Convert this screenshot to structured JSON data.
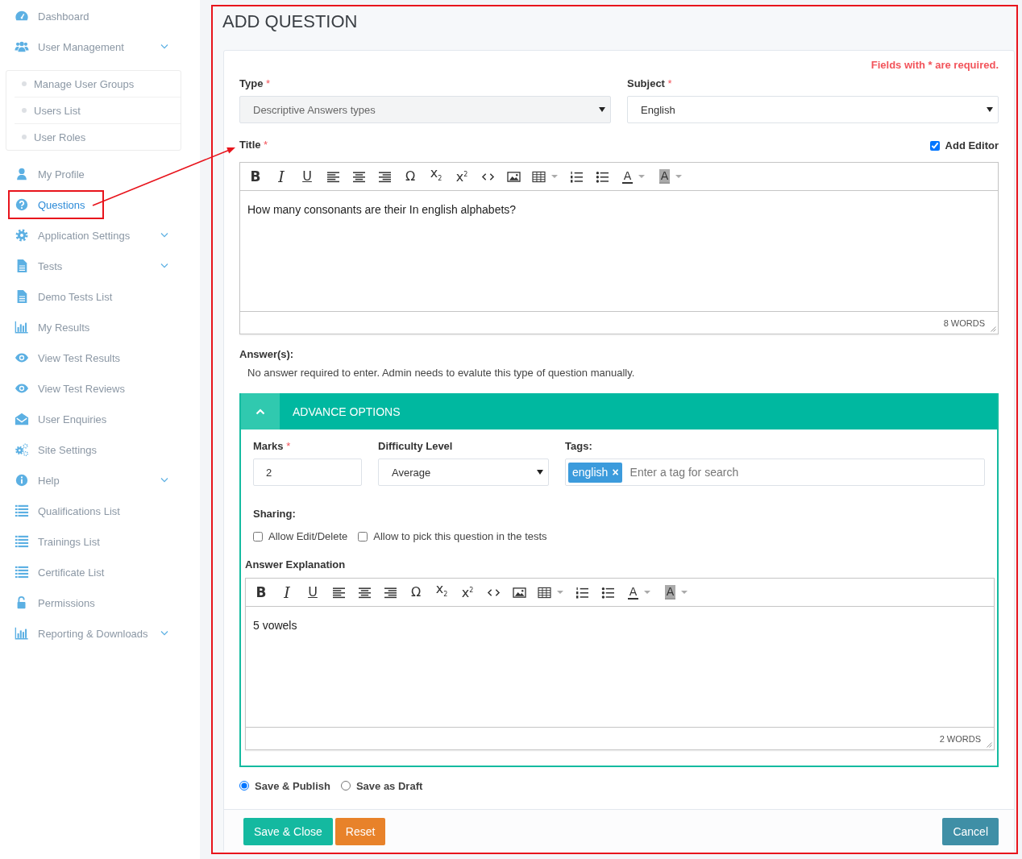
{
  "sidebar": {
    "items": [
      {
        "label": "Dashboard",
        "selected": false
      },
      {
        "label": "User Management",
        "selected": false,
        "has_submenu": true,
        "expanded": true,
        "children": [
          {
            "label": "Manage User Groups",
            "selected": false
          },
          {
            "label": "Users List",
            "selected": false
          },
          {
            "label": "User Roles",
            "selected": false
          }
        ]
      },
      {
        "label": "My Profile",
        "selected": false
      },
      {
        "label": "Questions",
        "selected": true
      },
      {
        "label": "Application Settings",
        "selected": false,
        "has_submenu": true
      },
      {
        "label": "Tests",
        "selected": false,
        "has_submenu": true
      },
      {
        "label": "Demo Tests List",
        "selected": false
      },
      {
        "label": "My Results",
        "selected": false
      },
      {
        "label": "View Test Results",
        "selected": false
      },
      {
        "label": "View Test Reviews",
        "selected": false
      },
      {
        "label": "User Enquiries",
        "selected": false
      },
      {
        "label": "Site Settings",
        "selected": false
      },
      {
        "label": "Help",
        "selected": false,
        "has_submenu": true
      },
      {
        "label": "Qualifications List",
        "selected": false
      },
      {
        "label": "Trainings List",
        "selected": false
      },
      {
        "label": "Certificate List",
        "selected": false
      },
      {
        "label": "Permissions",
        "selected": false
      },
      {
        "label": "Reporting & Downloads",
        "selected": false,
        "has_submenu": true
      }
    ]
  },
  "page": {
    "title": "ADD QUESTION"
  },
  "form": {
    "required_note": "Fields with * are required.",
    "type": {
      "label": "Type",
      "mark": "*",
      "value": "Descriptive Answers types",
      "disabled": true
    },
    "subject": {
      "label": "Subject",
      "mark": "*",
      "value": "English",
      "disabled": false
    },
    "title": {
      "label": "Title",
      "mark": "*",
      "add_editor": {
        "label": "Add Editor",
        "checked": true
      },
      "editor": {
        "toolbar": [
          {
            "kind": "bold",
            "label": "B"
          },
          {
            "kind": "italic",
            "label": "I"
          },
          {
            "kind": "underline",
            "label": "U"
          },
          {
            "kind": "icon"
          },
          {
            "kind": "icon"
          },
          {
            "kind": "icon"
          },
          {
            "kind": "plain",
            "label": "Ω"
          },
          {
            "kind": "plain",
            "label": "x$_{2}$"
          },
          {
            "kind": "plain",
            "label": "x$^{2}$"
          },
          {
            "kind": "icon"
          },
          {
            "kind": "icon"
          },
          {
            "kind": "icon",
            "has_menu": true
          },
          {
            "kind": "icon"
          },
          {
            "kind": "icon"
          },
          {
            "kind": "text_color",
            "label": "A",
            "has_menu": true
          },
          {
            "kind": "highlight",
            "label": "A",
            "has_menu": true
          }
        ],
        "content": "How many consonants are their In english alphabets?",
        "word_count": "8 WORDS"
      }
    },
    "answers": {
      "label": "Answer(s):",
      "note": "No answer required to enter. Admin needs to evalute this type of question manually."
    },
    "advance_options": {
      "title": "ADVANCE OPTIONS",
      "expanded": true,
      "marks": {
        "label": "Marks",
        "mark": "*",
        "value": "2"
      },
      "difficulty": {
        "label": "Difficulty Level",
        "value": "Average"
      },
      "tags": {
        "label": "Tags:",
        "tags": [
          {
            "label": "english",
            "remove": "×"
          }
        ],
        "placeholder": "Enter a tag for search"
      },
      "sharing": {
        "label": "Sharing:",
        "options": [
          {
            "label": "Allow Edit/Delete",
            "checked": false
          },
          {
            "label": "Allow to pick this question in the tests",
            "checked": false
          }
        ]
      },
      "explanation": {
        "label": "Answer Explanation",
        "editor": {
          "toolbar": [
            {
              "kind": "bold",
              "label": "B"
            },
            {
              "kind": "italic",
              "label": "I"
            },
            {
              "kind": "underline",
              "label": "U"
            },
            {
              "kind": "icon"
            },
            {
              "kind": "icon"
            },
            {
              "kind": "icon"
            },
            {
              "kind": "plain",
              "label": "Ω"
            },
            {
              "kind": "plain",
              "label": "x$_{2}$"
            },
            {
              "kind": "plain",
              "label": "x$^{2}$"
            },
            {
              "kind": "icon"
            },
            {
              "kind": "icon"
            },
            {
              "kind": "icon",
              "has_menu": true
            },
            {
              "kind": "icon"
            },
            {
              "kind": "icon"
            },
            {
              "kind": "text_color",
              "label": "A",
              "has_menu": true
            },
            {
              "kind": "highlight",
              "label": "A",
              "has_menu": true
            }
          ],
          "content": "5 vowels",
          "word_count": "2 WORDS"
        }
      }
    },
    "status": [
      {
        "label": "Save & Publish",
        "selected": true
      },
      {
        "label": "Save as Draft",
        "selected": false
      }
    ]
  },
  "buttons": [
    {
      "label": "Save & Close",
      "kind": "primary"
    },
    {
      "label": "Reset",
      "kind": "warning"
    },
    {
      "label": "Cancel",
      "kind": "info"
    }
  ]
}
